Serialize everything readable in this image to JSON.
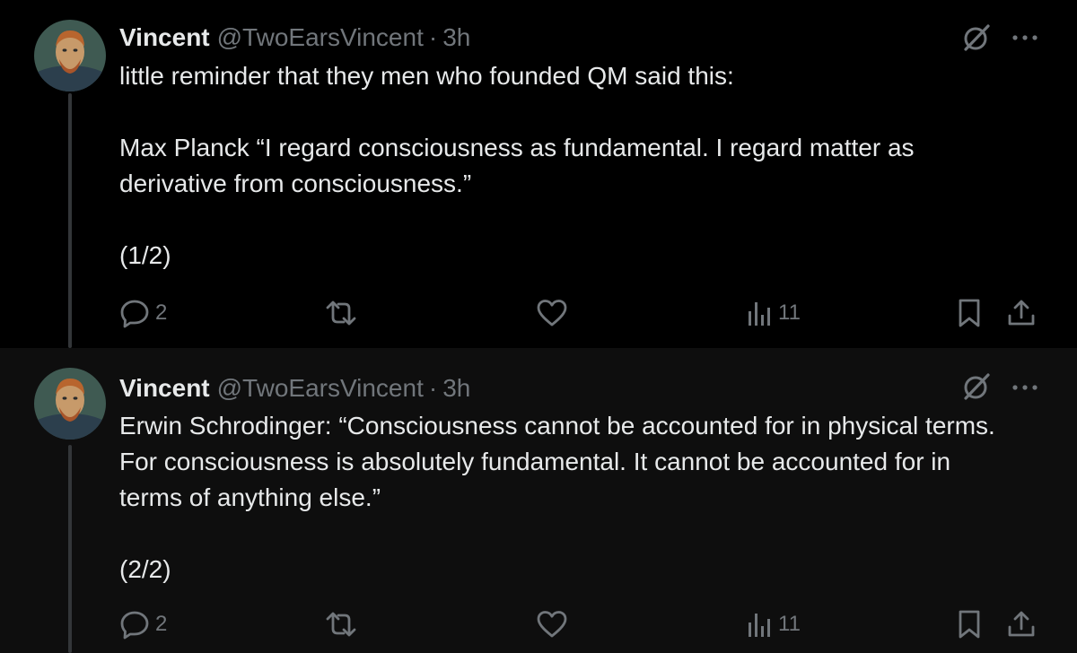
{
  "colors": {
    "background": "#000000",
    "background_alt": "#0e0e0e",
    "text_primary": "#e7e9ea",
    "text_secondary": "#71767b",
    "thread_line": "#333639"
  },
  "tweets": [
    {
      "author": {
        "name": "Vincent",
        "handle": "@TwoEarsVincent",
        "separator": "·",
        "time": "3h"
      },
      "paragraphs": [
        "little reminder that they men who founded QM said this:",
        "Max Planck  “I regard consciousness as fundamental. I regard matter as derivative from consciousness.”",
        "(1/2)"
      ],
      "actions": {
        "reply_count": "2",
        "retweet_count": "",
        "like_count": "",
        "views_count": "11"
      },
      "icons": [
        "grok-icon",
        "more-icon",
        "reply-icon",
        "retweet-icon",
        "like-icon",
        "views-icon",
        "bookmark-icon",
        "share-icon"
      ]
    },
    {
      "author": {
        "name": "Vincent",
        "handle": "@TwoEarsVincent",
        "separator": "·",
        "time": "3h"
      },
      "paragraphs": [
        "Erwin Schrodinger: “Consciousness cannot be accounted for in physical terms. For consciousness is absolutely fundamental. It cannot be accounted for in terms of anything else.”",
        "(2/2)"
      ],
      "actions": {
        "reply_count": "2",
        "retweet_count": "",
        "like_count": "",
        "views_count": "11"
      },
      "icons": [
        "grok-icon",
        "more-icon",
        "reply-icon",
        "retweet-icon",
        "like-icon",
        "views-icon",
        "bookmark-icon",
        "share-icon"
      ]
    }
  ]
}
